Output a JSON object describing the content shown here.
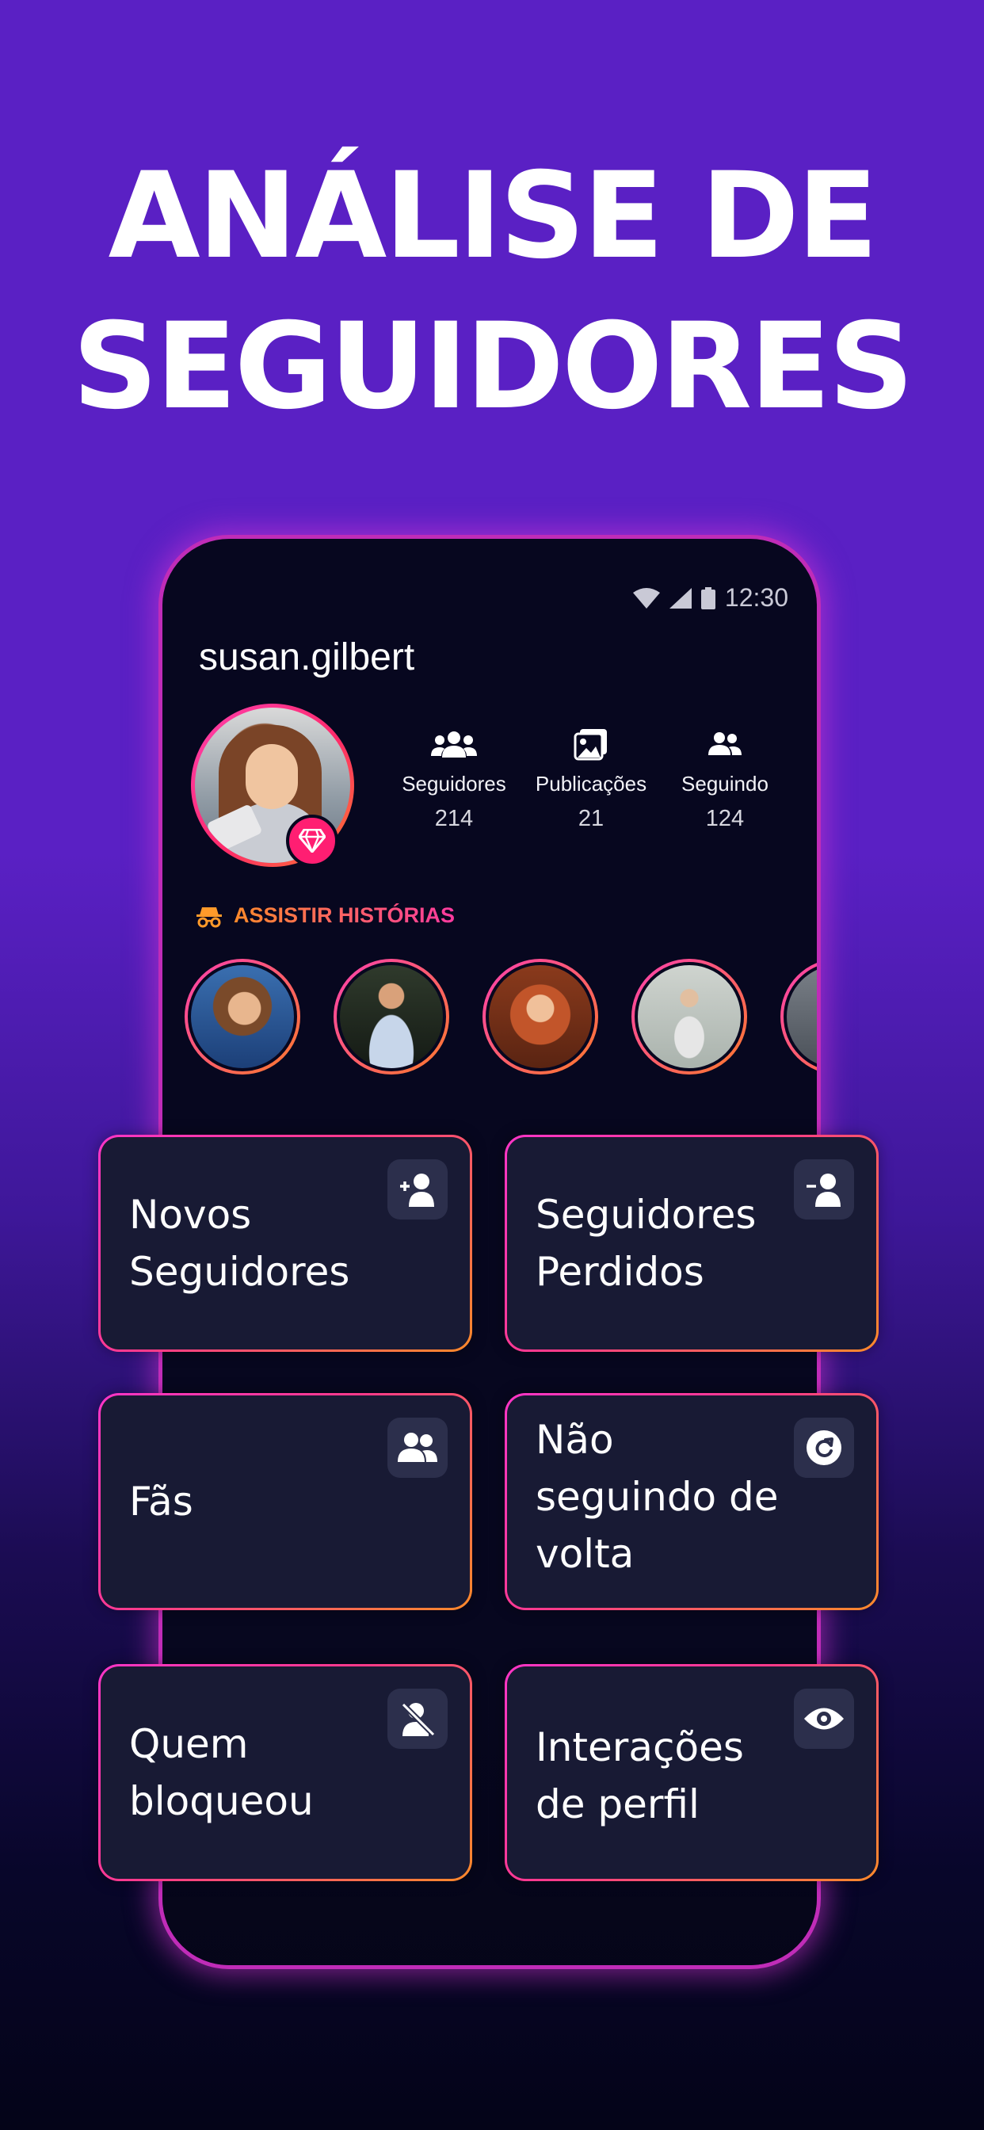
{
  "headline": {
    "line1": "ANÁLISE DE",
    "line2": "SEGUIDORES"
  },
  "phone": {
    "status_time": "12:30",
    "username": "susan.gilbert",
    "stats": [
      {
        "icon": "group-icon",
        "label": "Seguidores",
        "value": "214"
      },
      {
        "icon": "image-icon",
        "label": "Publicações",
        "value": "21"
      },
      {
        "icon": "two-people-icon",
        "label": "Seguindo",
        "value": "124"
      }
    ],
    "stories_title": "ASSISTIR HISTÓRIAS"
  },
  "cards": [
    {
      "label": "Novos Seguidores",
      "icon": "add-person-icon"
    },
    {
      "label": "Seguidores Perdidos",
      "icon": "remove-person-icon"
    },
    {
      "label": "Fãs",
      "icon": "people-icon"
    },
    {
      "label": "Não seguindo de volta",
      "icon": "refresh-icon"
    },
    {
      "label": "Quem bloqueou",
      "icon": "blocked-person-icon"
    },
    {
      "label": "Interações de perfil",
      "icon": "eye-icon"
    }
  ],
  "colors": {
    "background_top": "#5a20c4",
    "background_bottom": "#040418",
    "accent_pink": "#ff35c8",
    "accent_orange": "#ff8a2a",
    "card_bg": "#181a34"
  }
}
